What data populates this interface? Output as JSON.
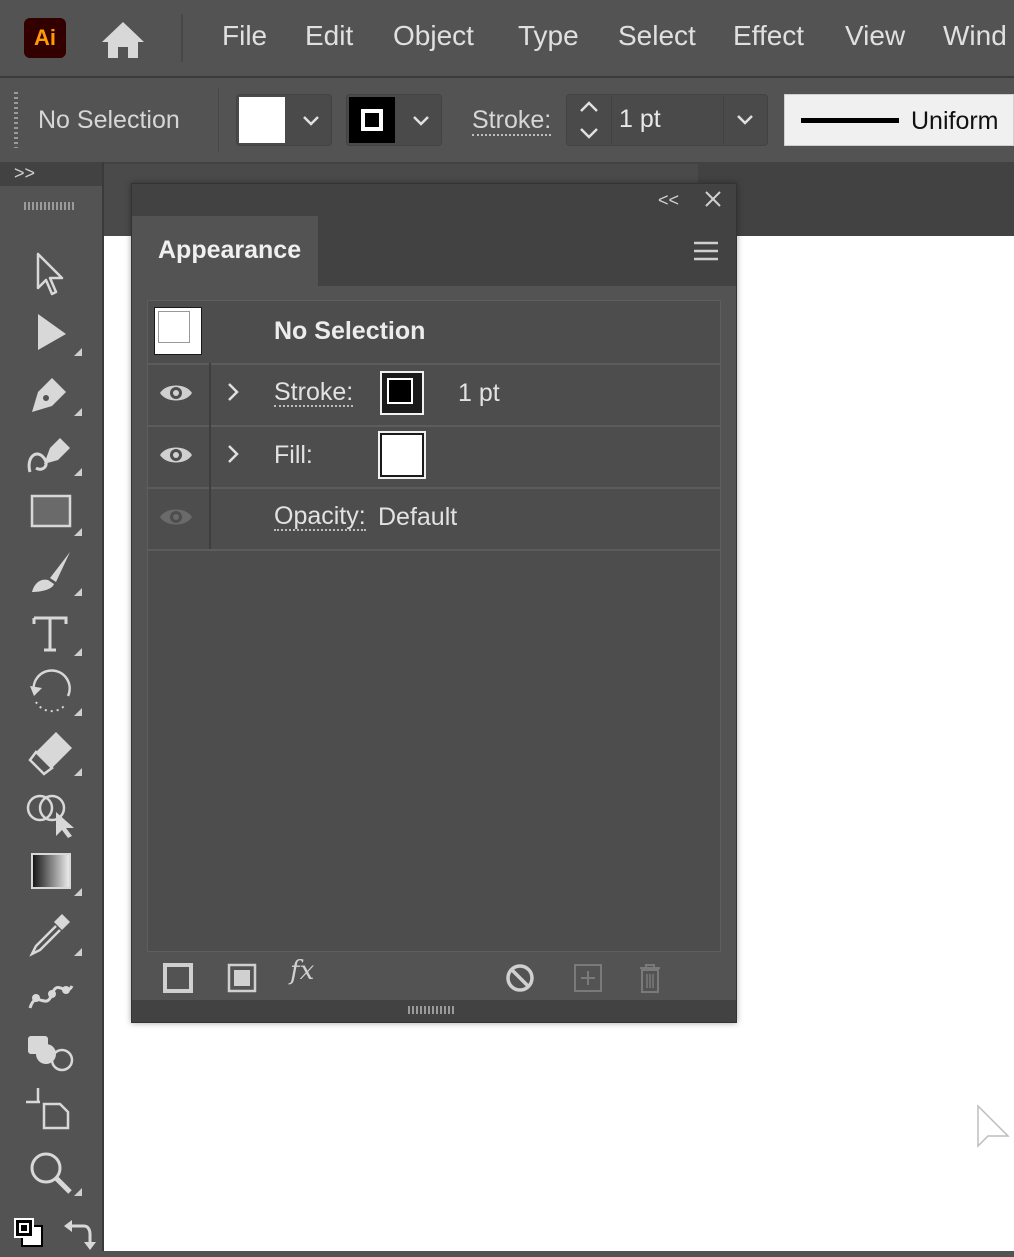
{
  "app": {
    "logo_text": "Ai",
    "accent_color": "#ff9a00",
    "logo_bg": "#330000"
  },
  "menu": {
    "items": [
      "File",
      "Edit",
      "Object",
      "Type",
      "Select",
      "Effect",
      "View",
      "Wind"
    ]
  },
  "control_bar": {
    "selection_status": "No Selection",
    "fill_color": "#ffffff",
    "stroke_color": "#000000",
    "stroke_label": "Stroke:",
    "stroke_value": "1 pt",
    "profile_label": "Uniform"
  },
  "tools_panel": {
    "collapse_glyph": ">>",
    "tools": [
      "selection-tool",
      "direct-selection-tool",
      "pen-tool",
      "curvature-tool",
      "rectangle-tool",
      "paintbrush-tool",
      "type-tool",
      "rotate-tool",
      "eraser-tool",
      "shape-builder-tool",
      "gradient-tool",
      "eyedropper-tool",
      "puppet-warp-tool",
      "symbol-sprayer-tool",
      "artboard-tool",
      "zoom-tool"
    ]
  },
  "appearance_panel": {
    "collapse_glyph": "<<",
    "tab_label": "Appearance",
    "header_label": "No Selection",
    "rows": {
      "stroke": {
        "label": "Stroke:",
        "value": "1 pt",
        "visible": true
      },
      "fill": {
        "label": "Fill:",
        "visible": true
      },
      "opacity": {
        "label": "Opacity:",
        "value": "Default",
        "visible": false
      }
    },
    "footer_buttons": [
      "add-new-stroke",
      "add-new-fill",
      "add-new-effect",
      "clear-appearance",
      "duplicate-selected-item",
      "delete-selected-item"
    ],
    "fx_label": "fx"
  }
}
